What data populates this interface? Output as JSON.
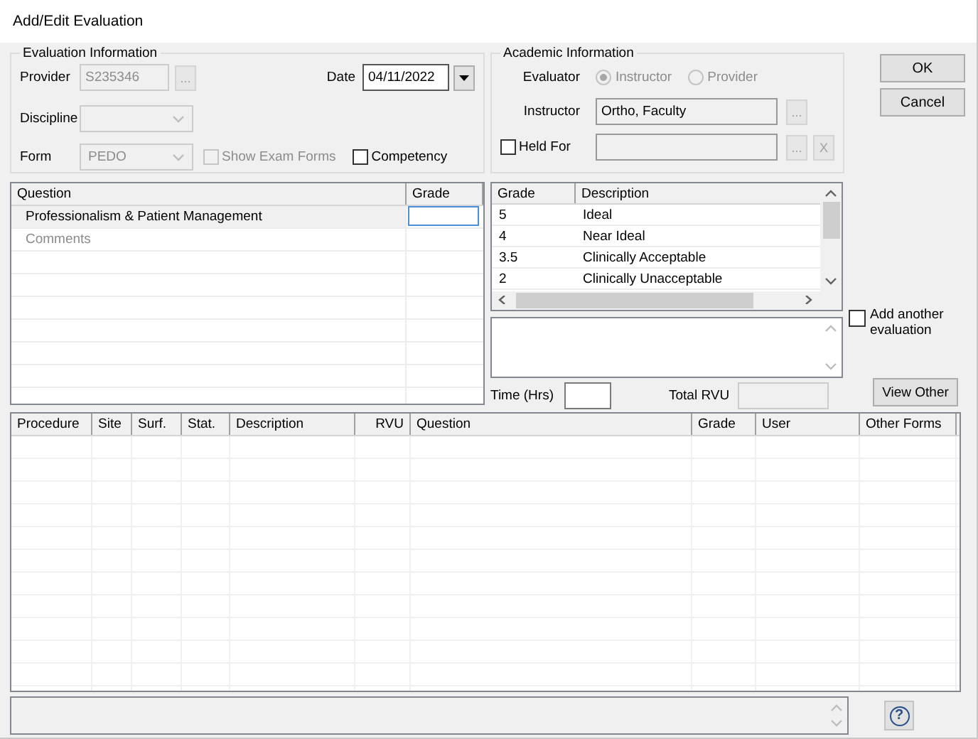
{
  "window": {
    "title": "Add/Edit Evaluation"
  },
  "evaluation_information": {
    "title": "Evaluation Information",
    "provider": {
      "label": "Provider",
      "value": "S235346",
      "disabled": true,
      "browse": "..."
    },
    "date": {
      "label": "Date",
      "value": "04/11/2022"
    },
    "discipline": {
      "label": "Discipline",
      "disabled": true
    },
    "form": {
      "label": "Form",
      "value": "PEDO",
      "disabled": true
    },
    "show_exam_forms": {
      "label": "Show Exam Forms",
      "checked": false,
      "disabled": true
    },
    "competency": {
      "label": "Competency",
      "checked": false,
      "disabled": false
    }
  },
  "academic_information": {
    "title": "Academic Information",
    "evaluator": {
      "label": "Evaluator",
      "disabled": true,
      "options": [
        {
          "label": "Instructor",
          "selected": true
        },
        {
          "label": "Provider",
          "selected": false
        }
      ]
    },
    "instructor": {
      "label": "Instructor",
      "value": "Ortho, Faculty",
      "browse": "..."
    },
    "held_for": {
      "label": "Held For",
      "checked": false,
      "browse": "...",
      "clear": "X"
    }
  },
  "buttons": [
    "OK",
    "Cancel"
  ],
  "questions": {
    "columns": [
      "Question",
      "Grade"
    ],
    "rows": [
      {
        "kind": "question",
        "question": "Professionalism & Patient Management",
        "selected": true
      },
      {
        "kind": "comment",
        "question": "Comments",
        "selected": false
      }
    ]
  },
  "grades": {
    "columns": [
      "Grade",
      "Description"
    ],
    "rows": [
      {
        "grade": "5",
        "description": "Ideal"
      },
      {
        "grade": "4",
        "description": "Near Ideal"
      },
      {
        "grade": "3.5",
        "description": "Clinically Acceptable"
      },
      {
        "grade": "2",
        "description": "Clinically Unacceptable"
      }
    ]
  },
  "add_another_evaluation": {
    "label": "Add another evaluation",
    "checked": false
  },
  "time": {
    "label": "Time (Hrs)"
  },
  "total_rvu": {
    "label": "Total RVU",
    "disabled": true
  },
  "view_other_button": "View Other",
  "procedures": {
    "columns": [
      {
        "label": "Procedure",
        "kind": "text"
      },
      {
        "label": "Site",
        "kind": "text"
      },
      {
        "label": "Surf.",
        "kind": "text"
      },
      {
        "label": "Stat.",
        "kind": "text"
      },
      {
        "label": "Description",
        "kind": "text"
      },
      {
        "label": "RVU",
        "kind": "number"
      },
      {
        "label": "Question",
        "kind": "text"
      },
      {
        "label": "Grade",
        "kind": "text"
      },
      {
        "label": "User",
        "kind": "text"
      },
      {
        "label": "Other Forms",
        "kind": "text"
      }
    ]
  },
  "help_button": "?"
}
